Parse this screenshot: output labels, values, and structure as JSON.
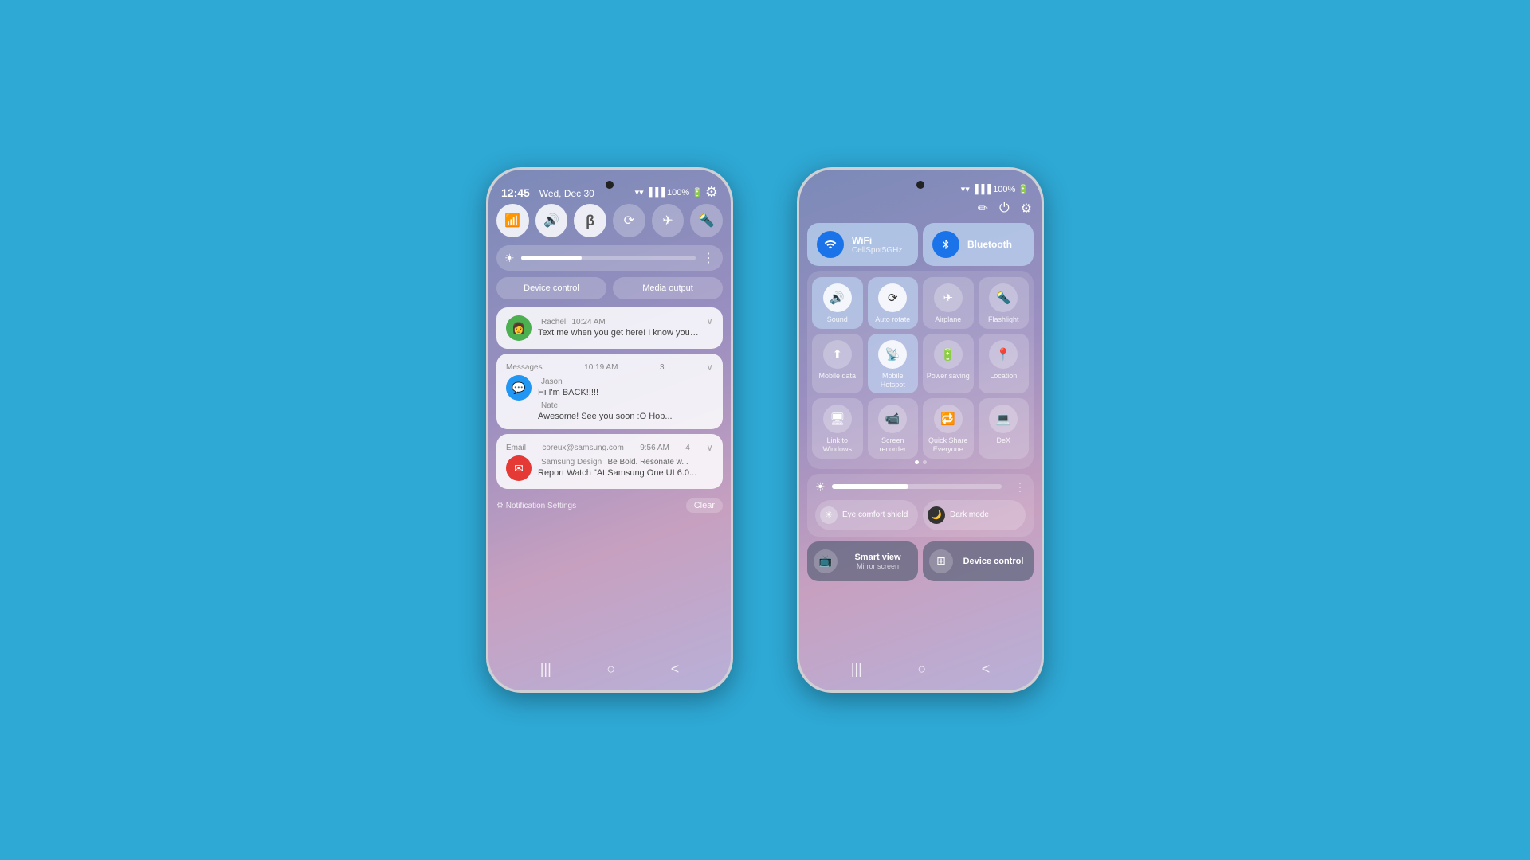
{
  "bg_color": "#2ea8d5",
  "phone1": {
    "status": {
      "time": "12:45",
      "date": "Wed, Dec 30",
      "wifi": "📶",
      "signal": "📶",
      "battery": "100%"
    },
    "toggles": [
      {
        "id": "wifi",
        "icon": "📶",
        "active": true
      },
      {
        "id": "sound",
        "icon": "🔊",
        "active": true
      },
      {
        "id": "bluetooth",
        "icon": "⬡",
        "active": true
      },
      {
        "id": "rotate",
        "icon": "🔄",
        "active": false
      },
      {
        "id": "airplane",
        "icon": "✈",
        "active": false
      },
      {
        "id": "flashlight",
        "icon": "🔦",
        "active": false
      }
    ],
    "device_control_label": "Device control",
    "media_output_label": "Media output",
    "notifications": [
      {
        "type": "direct",
        "app": "",
        "sender": "Rachel",
        "time": "10:24 AM",
        "avatar": "👩",
        "avatar_class": "green",
        "text": "Text me when you get here! I know you're probably having cravings. W...",
        "count": ""
      },
      {
        "type": "group",
        "app": "Messages",
        "time": "10:19 AM",
        "avatar": "💬",
        "avatar_class": "blue",
        "sender1": "Jason",
        "text1": "Hi I'm BACK!!!!!",
        "sender2": "Nate",
        "text2": "Awesome! See you soon :O Hop...",
        "count": "3"
      },
      {
        "type": "email",
        "app": "Email",
        "email": "coreux@samsung.com",
        "time": "9:56 AM",
        "avatar": "✉",
        "avatar_class": "red",
        "sender": "Samsung Design",
        "text1": "Be Bold. Resonate w...",
        "sender2": "Report",
        "text2": "Watch \"At Samsung One UI 6.0...",
        "count": "4"
      }
    ],
    "notification_settings": "⚙ Notification Settings",
    "clear_label": "Clear",
    "nav": [
      "|||",
      "○",
      "<"
    ]
  },
  "phone2": {
    "status": {
      "wifi": "📶",
      "signal": "📶",
      "battery": "100%"
    },
    "header_icons": [
      "✏",
      "⏻",
      "⚙"
    ],
    "wide_tiles": [
      {
        "id": "wifi",
        "icon": "📶",
        "label": "WiFi",
        "sub": "CellSpot5GHz",
        "active": true
      },
      {
        "id": "bluetooth",
        "icon": "⬡",
        "label": "Bluetooth",
        "sub": "",
        "active": true
      }
    ],
    "grid_tiles": [
      {
        "id": "sound",
        "icon": "🔊",
        "label": "Sound",
        "active": true
      },
      {
        "id": "auto-rotate",
        "icon": "🔄",
        "label": "Auto rotate",
        "active": true
      },
      {
        "id": "airplane",
        "icon": "✈",
        "label": "Airplane",
        "active": false
      },
      {
        "id": "flashlight",
        "icon": "🔦",
        "label": "Flashlight",
        "active": false
      },
      {
        "id": "mobile-data",
        "icon": "⬆",
        "label": "Mobile data",
        "active": false
      },
      {
        "id": "hotspot",
        "icon": "📡",
        "label": "Mobile Hotspot",
        "active": true
      },
      {
        "id": "power-saving",
        "icon": "🔋",
        "label": "Power saving",
        "active": false
      },
      {
        "id": "location",
        "icon": "📍",
        "label": "Location",
        "active": false
      },
      {
        "id": "link-windows",
        "icon": "🖥",
        "label": "Link to Windows",
        "active": false
      },
      {
        "id": "screen-recorder",
        "icon": "📹",
        "label": "Screen recorder",
        "active": false
      },
      {
        "id": "quick-share",
        "icon": "🔁",
        "label": "Quick Share Everyone",
        "active": false
      },
      {
        "id": "dex",
        "icon": "💻",
        "label": "DeX",
        "active": false
      }
    ],
    "dots": [
      true,
      false
    ],
    "extra_buttons": [
      {
        "id": "eye-comfort",
        "icon": "☀",
        "label": "Eye comfort shield"
      },
      {
        "id": "dark-mode",
        "icon": "🌙",
        "label": "Dark mode"
      }
    ],
    "action_tiles": [
      {
        "id": "smart-view",
        "icon": "📺",
        "label": "Smart view",
        "sub": "Mirror screen"
      },
      {
        "id": "device-control",
        "icon": "⊞",
        "label": "Device control",
        "sub": ""
      }
    ],
    "nav": [
      "|||",
      "○",
      "<"
    ]
  }
}
